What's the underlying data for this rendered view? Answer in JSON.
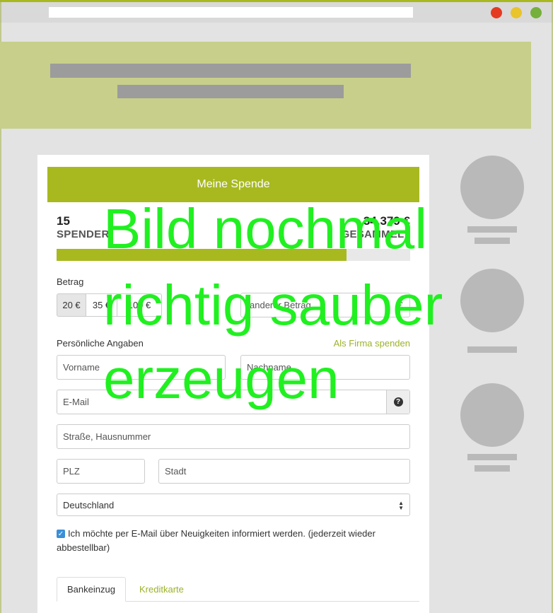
{
  "form": {
    "header": "Meine Spende",
    "donors_count": "15",
    "donors_label": "SPENDER",
    "collected_amount": "34.379 €",
    "collected_label": "GESAMMELT",
    "progress_fraction": 0.82,
    "amount_label": "Betrag",
    "amounts": [
      "20 €",
      "35 €",
      "100 €"
    ],
    "other_amount_placeholder": "anderer Betrag",
    "currency_symbol": "€",
    "personal_label": "Persönliche Angaben",
    "company_link": "Als Firma spenden",
    "firstname_placeholder": "Vorname",
    "lastname_placeholder": "Nachname",
    "email_placeholder": "E-Mail",
    "help_glyph": "?",
    "street_placeholder": "Straße, Hausnummer",
    "zip_placeholder": "PLZ",
    "city_placeholder": "Stadt",
    "country_value": "Deutschland",
    "newsletter_text": "Ich möchte per E-Mail über Neuigkeiten informiert werden. (jederzeit wieder abbestellbar)",
    "newsletter_checked": true,
    "tabs": [
      "Bankeinzug",
      "Kreditkarte"
    ]
  },
  "overlay": {
    "line1": "Bild nochmal",
    "line2": "richtig sauber",
    "line3": "erzeugen",
    "color": "#20f020"
  },
  "colors": {
    "accent": "#a8b920",
    "banner": "#c8cf8a",
    "placeholder": "#b9b9b9"
  }
}
